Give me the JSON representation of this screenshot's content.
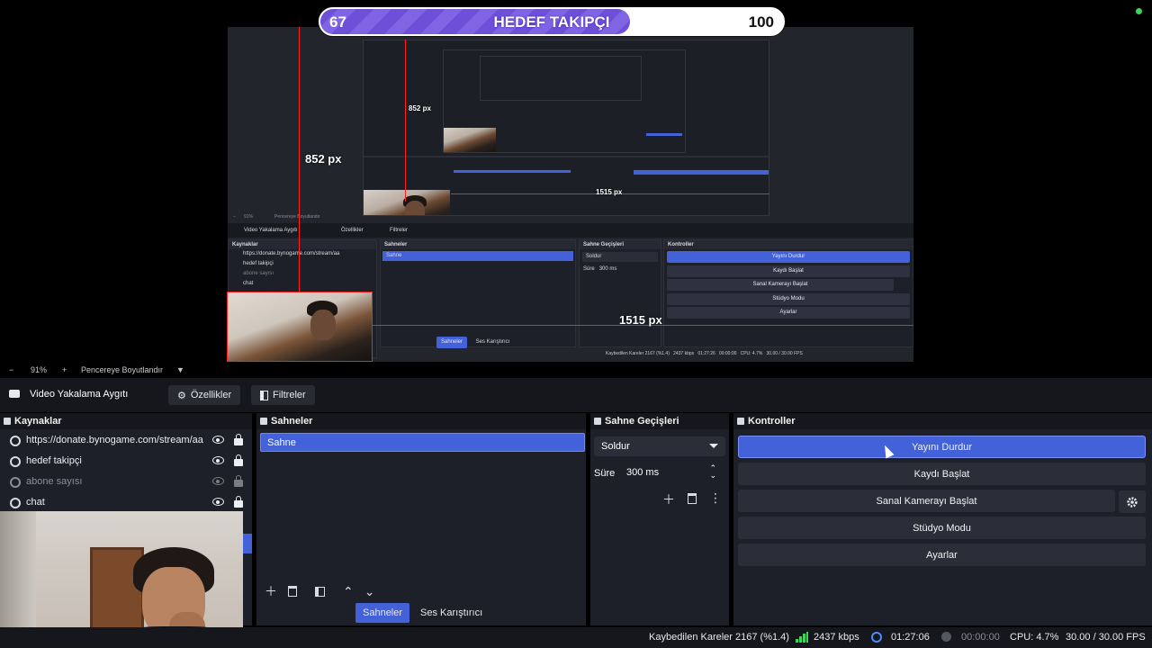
{
  "overlay": {
    "goal_current": "67",
    "goal_title": "HEDEF TAKIPÇI",
    "goal_target": "100",
    "goal_progress": 0.67
  },
  "preview": {
    "measure_vertical_l1": "852 px",
    "measure_vertical_l2": "852 px",
    "measure_horizontal_l1": "1515 px",
    "measure_horizontal_l2": "1515 px"
  },
  "zoom_bar": {
    "minus": "−",
    "zoom": "91%",
    "plus": "+",
    "resize_label": "Pencereye Boyutlandır",
    "caret": "▼"
  },
  "source_toolbar": {
    "source_name": "Video Yakalama Aygıtı",
    "properties": "Özellikler",
    "filters": "Filtreler"
  },
  "sources": {
    "title": "Kaynaklar",
    "items": [
      {
        "label": "https://donate.bynogame.com/stream/aa",
        "visible": true
      },
      {
        "label": "hedef takipçi",
        "visible": true
      },
      {
        "label": "abone sayısı",
        "visible": false
      },
      {
        "label": "chat",
        "visible": true
      }
    ]
  },
  "scenes": {
    "title": "Sahneler",
    "items": [
      "Sahne"
    ]
  },
  "transitions": {
    "title": "Sahne Geçişleri",
    "selected": "Soldur",
    "duration_label": "Süre",
    "duration_value": "300 ms"
  },
  "controls": {
    "title": "Kontroller",
    "stop_stream": "Yayını Durdur",
    "start_recording": "Kaydı Başlat",
    "start_virtual_cam": "Sanal Kamerayı Başlat",
    "studio_mode": "Stüdyo Modu",
    "settings": "Ayarlar"
  },
  "dock_tabs": {
    "scenes": "Sahneler",
    "audio_mixer": "Ses Karıştırıcı"
  },
  "statusbar": {
    "dropped_frames": "Kaybedilen Kareler 2167 (%1.4)",
    "bitrate": "2437 kbps",
    "stream_time": "01:27:06",
    "record_time": "00:00:00",
    "cpu": "CPU: 4.7%",
    "fps": "30.00 / 30.00 FPS"
  },
  "mini_level1": {
    "source_name": "Video Yakalama Aygıtı",
    "properties": "Özellikler",
    "filters": "Filtreler",
    "sources_title": "Kaynaklar",
    "scenes_title": "Sahneler",
    "transitions_title": "Sahne Geçişleri",
    "controls_title": "Kontroller",
    "src1": "https://donate.bynogame.com/stream/aa",
    "src2": "hedef takipçi",
    "src3": "abone sayısı",
    "src4": "chat",
    "scene": "Sahne",
    "transition": "Soldur",
    "duration_label": "Süre",
    "duration_value": "300 ms",
    "btn1": "Yayını Durdur",
    "btn2": "Kaydı Başlat",
    "btn3": "Sanal Kamerayı Başlat",
    "btn4": "Stüdyo Modu",
    "btn5": "Ayarlar",
    "tab1": "Sahneler",
    "tab2": "Ses Karıştırıcı",
    "zoom": "91%",
    "resize": "Pencereye Boyutlandır",
    "status_dropped": "Kaybedilen Kareler 2167 (%1.4)",
    "status_kbps": "2437 kbps",
    "status_time": "01:27:26",
    "status_rec": "00:00:00",
    "status_cpu": "CPU: 4.7%",
    "status_fps": "30.00 / 30.00 FPS"
  },
  "colors": {
    "accent": "#4361d8",
    "guide_red": "#ff1f1f",
    "panel_bg": "#1e2029",
    "goal_fill": "#6d4fd8"
  }
}
